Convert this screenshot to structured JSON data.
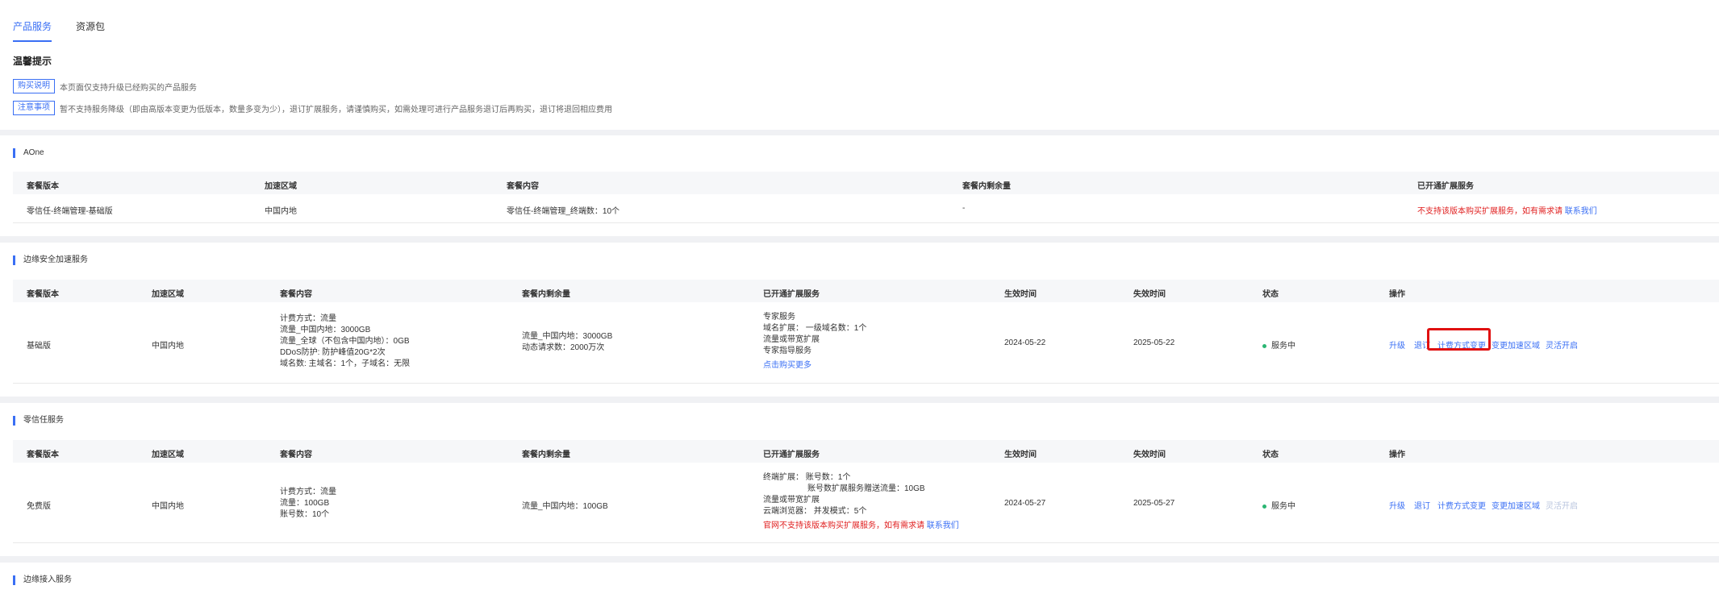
{
  "tabs": [
    "产品服务",
    "资源包"
  ],
  "tips": {
    "title": "温馨提示",
    "items": [
      {
        "tag": "购买说明",
        "text": "本页面仅支持升级已经购买的产品服务"
      },
      {
        "tag": "注意事项",
        "text": "暂不支持服务降级（即由高版本变更为低版本，数量多变为少），退订扩展服务，请谨慎购买，如需处理可进行产品服务退订后再购买，退订将退回相应费用"
      }
    ]
  },
  "aone": {
    "title": "AOne",
    "headers": [
      "套餐版本",
      "加速区域",
      "套餐内容",
      "套餐内剩余量",
      "已开通扩展服务"
    ],
    "row": {
      "version": "零信任-终端管理-基础版",
      "region": "中国内地",
      "content": "零信任-终端管理_终端数：10个",
      "remaining": "-",
      "ext_note": "不支持该版本购买扩展服务，如有需求请",
      "ext_link": "联系我们"
    }
  },
  "edge_security": {
    "title": "边缘安全加速服务",
    "headers": [
      "套餐版本",
      "加速区域",
      "套餐内容",
      "套餐内剩余量",
      "已开通扩展服务",
      "生效时间",
      "失效时间",
      "状态",
      "操作"
    ],
    "row": {
      "version": "基础版",
      "region": "中国内地",
      "content": [
        "计费方式：流量",
        "流量_中国内地：3000GB",
        "流量_全球（不包含中国内地）：0GB",
        "DDoS防护: 防护峰值20G*2次",
        "域名数: 主域名：1个，子域名：无限"
      ],
      "remaining": [
        "流量_中国内地：3000GB",
        "动态请求数：2000万次"
      ],
      "ext": [
        "专家服务",
        "域名扩展： 一级域名数：1个",
        "流量或带宽扩展",
        "专家指导服务"
      ],
      "ext_link": "点击购买更多",
      "start": "2024-05-22",
      "end": "2025-05-22",
      "status": "服务中",
      "actions": [
        "升级",
        "退订",
        "计费方式变更",
        "变更加速区域",
        "灵活开启"
      ]
    }
  },
  "zero_trust": {
    "title": "零信任服务",
    "headers": [
      "套餐版本",
      "加速区域",
      "套餐内容",
      "套餐内剩余量",
      "已开通扩展服务",
      "生效时间",
      "失效时间",
      "状态",
      "操作"
    ],
    "row": {
      "version": "免费版",
      "region": "中国内地",
      "content": [
        "计费方式：流量",
        "流量：100GB",
        "账号数：10个"
      ],
      "remaining": [
        "流量_中国内地：100GB"
      ],
      "ext": [
        "终端扩展： 账号数：1个",
        "账号数扩展服务赠送流量：10GB",
        "流量或带宽扩展",
        "云端浏览器： 并发模式：5个"
      ],
      "ext_note": "官网不支持该版本购买扩展服务，如有需求请",
      "ext_link": "联系我们",
      "start": "2024-05-27",
      "end": "2025-05-27",
      "status": "服务中",
      "actions": [
        "升级",
        "退订",
        "计费方式变更",
        "变更加速区域",
        "灵活开启"
      ]
    }
  },
  "edge_access": {
    "title": "边缘接入服务"
  },
  "colors": {
    "accent": "#3a6ff4",
    "alert": "#e02020",
    "success": "#2bb673",
    "highlight": "#e01010"
  }
}
